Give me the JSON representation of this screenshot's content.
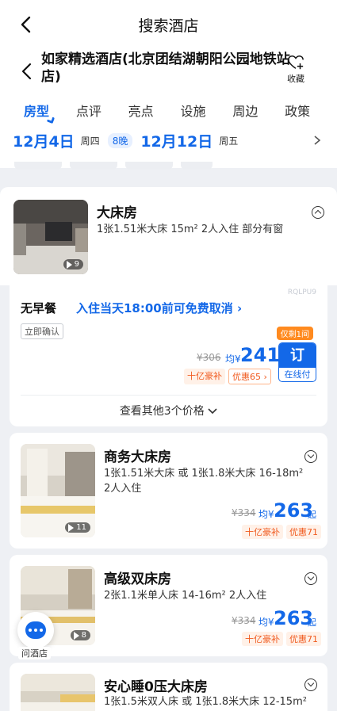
{
  "topbar": {
    "title": "搜索酒店"
  },
  "hotel": {
    "name": "如家精选酒店(北京团结湖朝阳公园地铁站店)",
    "fav_label": "收藏"
  },
  "tabs": [
    "房型",
    "点评",
    "亮点",
    "设施",
    "周边",
    "政策"
  ],
  "dates": {
    "checkin": "12月4日",
    "checkin_week": "周四",
    "nights": "8晚",
    "checkout": "12月12日",
    "checkout_week": "周五"
  },
  "rooms": [
    {
      "name": "大床房",
      "desc": "1张1.51米大床  15m²  2人入住  部分有窗",
      "video_count": "9",
      "expanded": true
    },
    {
      "name": "商务大床房",
      "desc": "1张1.51米大床 或 1张1.8米大床  16-18m²  2人入住",
      "video_count": "11",
      "orig_price": "¥334",
      "avg_label": "均¥",
      "price": "263",
      "qi": "起",
      "tags": [
        "十亿豪补",
        "优惠71"
      ]
    },
    {
      "name": "高级双床房",
      "desc": "2张1.1米单人床  14-16m²  2人入住",
      "video_count": "8",
      "orig_price": "¥334",
      "avg_label": "均¥",
      "price": "263",
      "qi": "起",
      "tags": [
        "十亿豪补",
        "优惠71"
      ]
    },
    {
      "name": "安心睡0压大床房",
      "desc": "1张1.5米双人床 或 1张1.8米大床  12-15m²"
    }
  ],
  "rate": {
    "watermark": "RQLPU9",
    "meal": "无早餐",
    "cancel": "入住当天18:00前可免费取消 ›",
    "confirm": "立即确认",
    "limit": "仅剩1间",
    "orig_price": "¥306",
    "avg_label": "均¥",
    "price": "241",
    "book": "订",
    "pay": "在线付",
    "tags": [
      "十亿豪补",
      "优惠65 ›"
    ],
    "more": "查看其他3个价格"
  },
  "assistant": {
    "label": "问酒店"
  },
  "colors": {
    "accent": "#1368e8",
    "orange": "#f05a1e",
    "badge": "#ff8a1f"
  }
}
